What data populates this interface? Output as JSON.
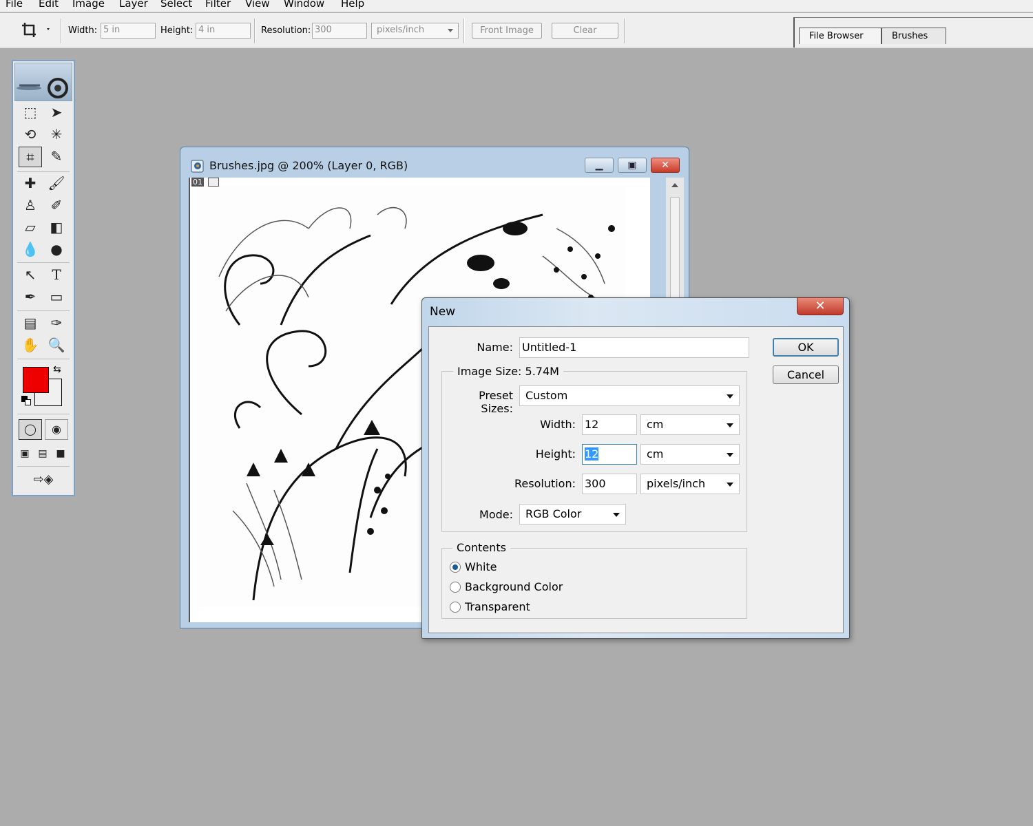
{
  "menu": [
    "File",
    "Edit",
    "Image",
    "Layer",
    "Select",
    "Filter",
    "View",
    "Window",
    "Help"
  ],
  "options": {
    "width_label": "Width:",
    "width_value": "5 in",
    "height_label": "Height:",
    "height_value": "4 in",
    "resolution_label": "Resolution:",
    "resolution_value": "300",
    "resolution_unit": "pixels/inch",
    "front_image": "Front Image",
    "clear": "Clear"
  },
  "palette_well": {
    "tabs": [
      "File Browser",
      "Brushes"
    ]
  },
  "colors": {
    "foreground": "#ee0000",
    "background": "#f0f0f0"
  },
  "document": {
    "title": "Brushes.jpg @ 200% (Layer 0, RGB)",
    "page_indicator": "01"
  },
  "dialog": {
    "title": "New",
    "close": "✕",
    "name_label": "Name:",
    "name_value": "Untitled-1",
    "image_size": "Image Size: 5.74M",
    "preset_label": "Preset Sizes:",
    "preset_value": "Custom",
    "width_label": "Width:",
    "width_value": "12",
    "width_unit": "cm",
    "height_label": "Height:",
    "height_value": "12",
    "height_unit": "cm",
    "resolution_label": "Resolution:",
    "resolution_value": "300",
    "resolution_unit": "pixels/inch",
    "mode_label": "Mode:",
    "mode_value": "RGB Color",
    "contents_label": "Contents",
    "contents_options": [
      "White",
      "Background Color",
      "Transparent"
    ],
    "contents_selected": "White",
    "ok": "OK",
    "cancel": "Cancel"
  }
}
